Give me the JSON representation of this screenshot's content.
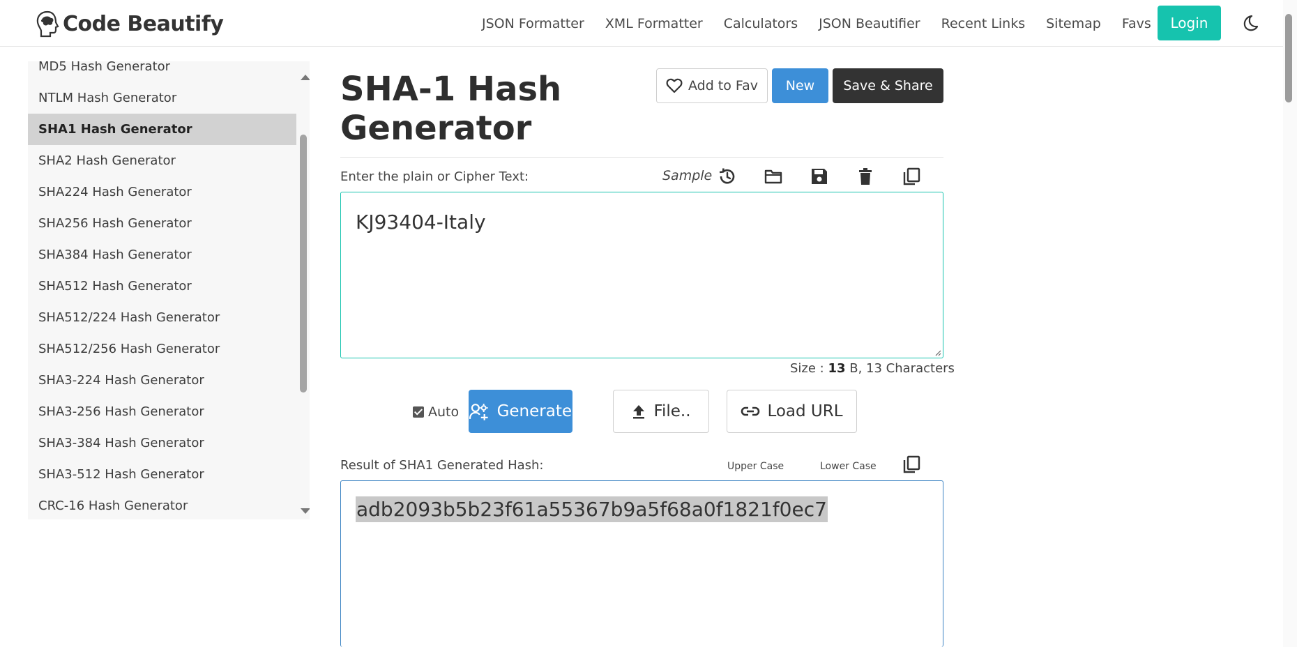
{
  "navbar": {
    "logo_text": "Code Beautify",
    "links": [
      "JSON Formatter",
      "XML Formatter",
      "Calculators",
      "JSON Beautifier",
      "Recent Links",
      "Sitemap"
    ],
    "favs_label": "Favs",
    "login_label": "Login",
    "accent_color": "#16c3ae"
  },
  "sidebar": {
    "items": [
      {
        "label": "MD5 Hash Generator"
      },
      {
        "label": "NTLM Hash Generator"
      },
      {
        "label": "SHA1 Hash Generator",
        "active": true
      },
      {
        "label": "SHA2 Hash Generator"
      },
      {
        "label": "SHA224 Hash Generator"
      },
      {
        "label": "SHA256 Hash Generator"
      },
      {
        "label": "SHA384 Hash Generator"
      },
      {
        "label": "SHA512 Hash Generator"
      },
      {
        "label": "SHA512/224 Hash Generator"
      },
      {
        "label": "SHA512/256 Hash Generator"
      },
      {
        "label": "SHA3-224 Hash Generator"
      },
      {
        "label": "SHA3-256 Hash Generator"
      },
      {
        "label": "SHA3-384 Hash Generator"
      },
      {
        "label": "SHA3-512 Hash Generator"
      },
      {
        "label": "CRC-16 Hash Generator"
      }
    ]
  },
  "main": {
    "title": "SHA-1 Hash Generator",
    "add_fav_label": "Add to Fav",
    "new_label": "New",
    "save_share_label": "Save & Share",
    "input_label": "Enter the plain or Cipher Text:",
    "sample_label": "Sample",
    "input_value": "KJ93404-Italy",
    "size": {
      "prefix": "Size : ",
      "bytes": "13",
      "suffix": " B, 13 Characters"
    },
    "auto_label": "Auto",
    "generate_label": "Generate",
    "file_label": "File..",
    "load_url_label": "Load URL",
    "result_label": "Result of SHA1 Generated Hash:",
    "upper_case_label": "Upper Case",
    "lower_case_label": "Lower Case",
    "result_value": "adb2093b5b23f61a55367b9a5f68a0f1821f0ec7"
  }
}
